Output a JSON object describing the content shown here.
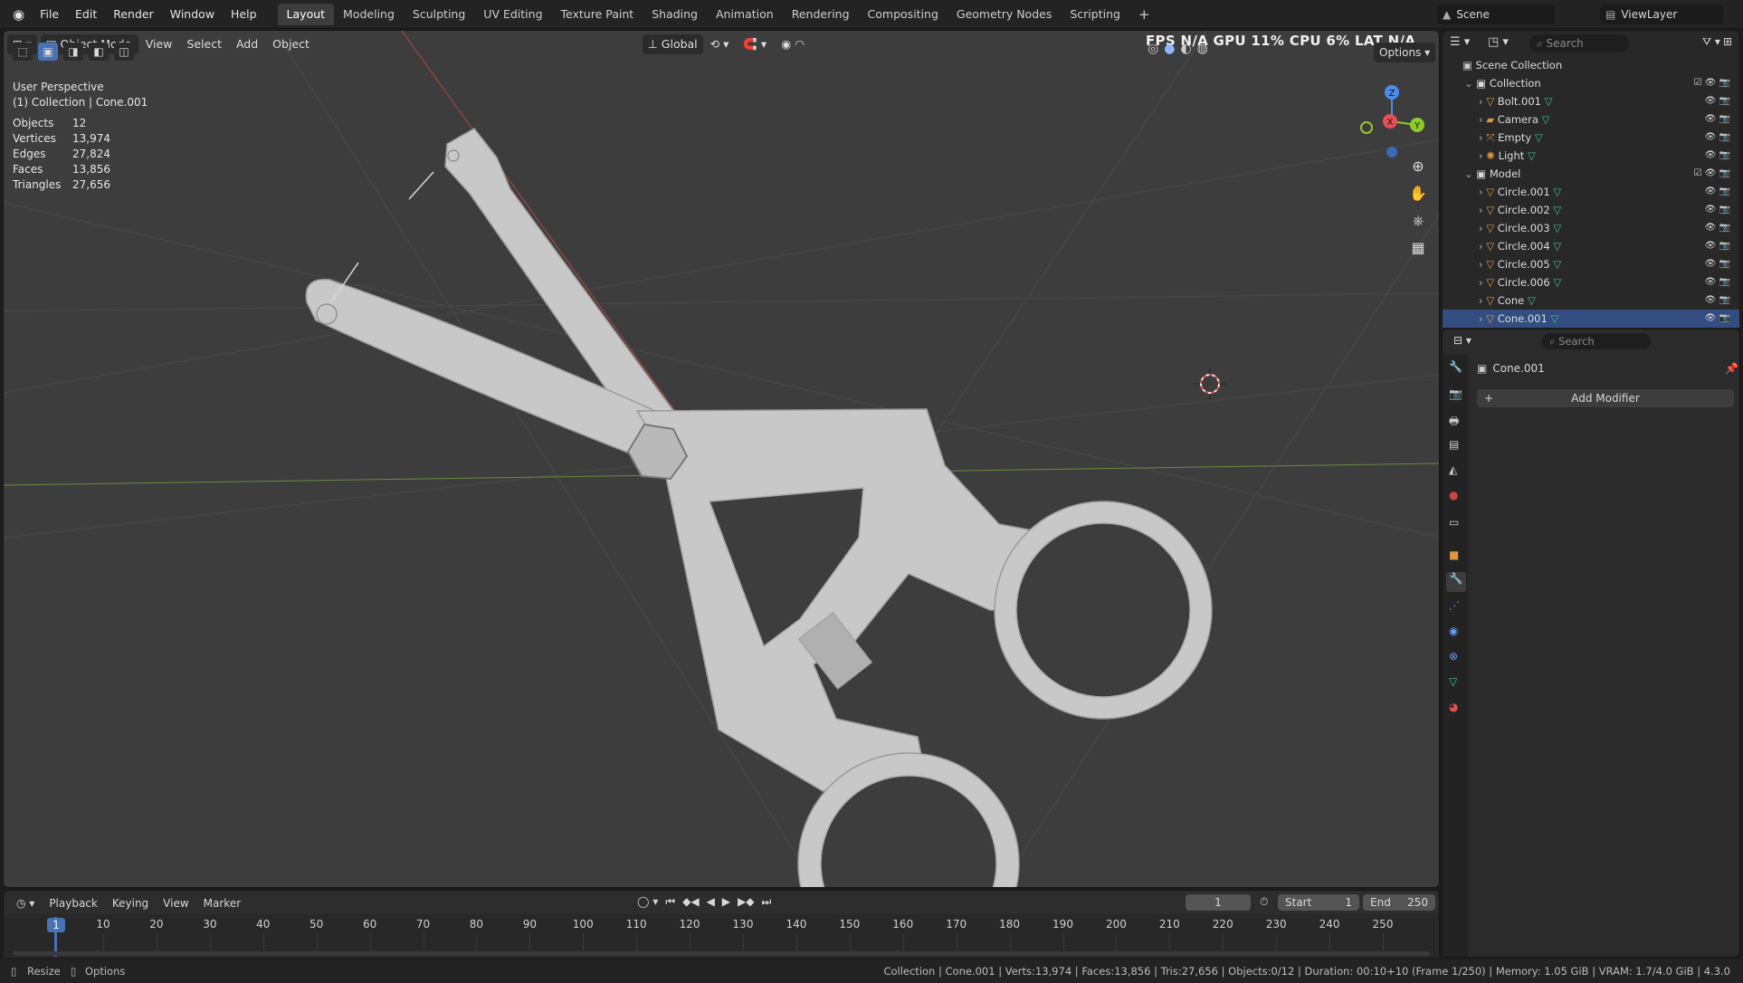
{
  "app_menu": [
    "File",
    "Edit",
    "Render",
    "Window",
    "Help"
  ],
  "workspaces": [
    "Layout",
    "Modeling",
    "Sculpting",
    "UV Editing",
    "Texture Paint",
    "Shading",
    "Animation",
    "Rendering",
    "Compositing",
    "Geometry Nodes",
    "Scripting"
  ],
  "active_workspace": "Layout",
  "scene_name": "Scene",
  "view_layer": "ViewLayer",
  "perf_overlay": "FPS  N/A  GPU  11%  CPU  6%  LAT  N/A",
  "viewport": {
    "mode": "Object Mode",
    "menus": [
      "View",
      "Select",
      "Add",
      "Object"
    ],
    "orientation": "Global",
    "options_label": "Options",
    "view_name": "User Perspective",
    "collection_label": "(1) Collection | Cone.001",
    "stats": [
      {
        "label": "Objects",
        "value": "12"
      },
      {
        "label": "Vertices",
        "value": "13,974"
      },
      {
        "label": "Edges",
        "value": "27,824"
      },
      {
        "label": "Faces",
        "value": "13,856"
      },
      {
        "label": "Triangles",
        "value": "27,656"
      }
    ],
    "gizmo": {
      "z": "Z",
      "x": "X",
      "y": "Y"
    }
  },
  "outliner": {
    "search_placeholder": "Search",
    "root": "Scene Collection",
    "items": [
      {
        "name": "Collection",
        "indent": 1,
        "type": "collection"
      },
      {
        "name": "Bolt.001",
        "indent": 2,
        "type": "mesh"
      },
      {
        "name": "Camera",
        "indent": 2,
        "type": "camera"
      },
      {
        "name": "Empty",
        "indent": 2,
        "type": "empty"
      },
      {
        "name": "Light",
        "indent": 2,
        "type": "light"
      },
      {
        "name": "Model",
        "indent": 1,
        "type": "collection"
      },
      {
        "name": "Circle.001",
        "indent": 2,
        "type": "mesh"
      },
      {
        "name": "Circle.002",
        "indent": 2,
        "type": "mesh"
      },
      {
        "name": "Circle.003",
        "indent": 2,
        "type": "mesh"
      },
      {
        "name": "Circle.004",
        "indent": 2,
        "type": "mesh"
      },
      {
        "name": "Circle.005",
        "indent": 2,
        "type": "mesh"
      },
      {
        "name": "Circle.006",
        "indent": 2,
        "type": "mesh"
      },
      {
        "name": "Cone",
        "indent": 2,
        "type": "mesh"
      },
      {
        "name": "Cone.001",
        "indent": 2,
        "type": "mesh"
      }
    ]
  },
  "properties": {
    "search_placeholder": "Search",
    "object_name": "Cone.001",
    "add_modifier": "Add Modifier"
  },
  "timeline": {
    "menus": [
      "Playback",
      "Keying",
      "View",
      "Marker"
    ],
    "current_frame": "1",
    "start_label": "Start",
    "start": "1",
    "end_label": "End",
    "end": "250",
    "ticks": [
      "10",
      "20",
      "30",
      "40",
      "50",
      "60",
      "70",
      "80",
      "90",
      "100",
      "110",
      "120",
      "130",
      "140",
      "150",
      "160",
      "170",
      "180",
      "190",
      "200",
      "210",
      "220",
      "230",
      "240",
      "250"
    ],
    "playhead": "1"
  },
  "statusbar": {
    "left1": "Resize",
    "left2": "Options",
    "right": "Collection | Cone.001 | Verts:13,974 | Faces:13,856 | Tris:27,656 | Objects:0/12 | Duration: 00:10+10 (Frame 1/250) | Memory: 1.05 GiB | VRAM: 1.7/4.0 GiB | 4.3.0"
  },
  "colors": {
    "accent": "#4772b3",
    "mesh_icon": "#e0963e",
    "vertex_green": "#3ac48a",
    "axis_x": "#e94e59",
    "axis_y": "#8fcc2a",
    "axis_z": "#4a8cf0"
  }
}
